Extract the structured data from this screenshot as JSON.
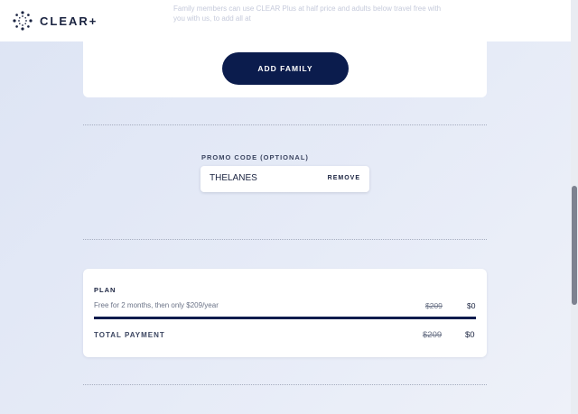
{
  "brand": {
    "name": "CLEAR+"
  },
  "header": {
    "faded_text": "Family members can use CLEAR Plus at half price and adults below travel free with you with us, to add all at"
  },
  "family": {
    "add_button_label": "ADD FAMILY"
  },
  "promo": {
    "label": "PROMO CODE (OPTIONAL)",
    "value": "THELANES",
    "remove_label": "REMOVE"
  },
  "plan": {
    "title": "PLAN",
    "description": "Free for 2 months, then only $209/year",
    "original_price": "$209",
    "price": "$0",
    "total_label": "TOTAL PAYMENT",
    "total_original": "$209",
    "total_price": "$0"
  },
  "colors": {
    "primary": "#0b1c4d",
    "background": "#e3e8f5",
    "card": "#ffffff"
  }
}
